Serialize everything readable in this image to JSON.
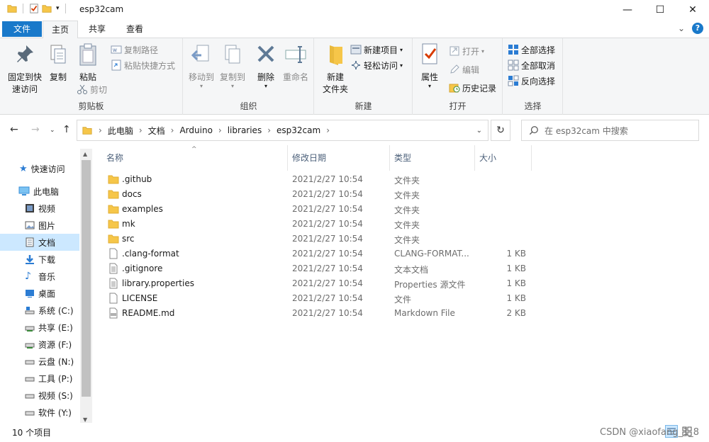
{
  "window": {
    "title": "esp32cam",
    "minimize": "—",
    "maximize": "☐",
    "close": "✕"
  },
  "tabs": {
    "file": "文件",
    "home": "主页",
    "share": "共享",
    "view": "查看",
    "expand": "⌄",
    "help": "?"
  },
  "ribbon": {
    "clipboard": {
      "label": "剪贴板",
      "pin": "固定到快\n速访问",
      "copy": "复制",
      "paste": "粘贴",
      "copy_path": "复制路径",
      "paste_shortcut": "粘贴快捷方式",
      "cut": "剪切"
    },
    "organize": {
      "label": "组织",
      "move_to": "移动到",
      "copy_to": "复制到",
      "delete": "删除",
      "rename": "重命名"
    },
    "new": {
      "label": "新建",
      "new_folder": "新建\n文件夹",
      "new_item": "新建项目",
      "easy_access": "轻松访问"
    },
    "open": {
      "label": "打开",
      "properties": "属性",
      "open": "打开",
      "edit": "编辑",
      "history": "历史记录"
    },
    "select": {
      "label": "选择",
      "select_all": "全部选择",
      "select_none": "全部取消",
      "invert": "反向选择"
    }
  },
  "address": {
    "crumbs": [
      "此电脑",
      "文档",
      "Arduino",
      "libraries",
      "esp32cam"
    ],
    "search_placeholder": "在 esp32cam 中搜索"
  },
  "sidebar": {
    "items": [
      {
        "label": "快速访问",
        "icon": "star-icon",
        "color": "#2b7cd3"
      },
      {
        "label": "此电脑",
        "icon": "computer-icon",
        "color": "#3a8fd8"
      },
      {
        "label": "视频",
        "icon": "video-icon",
        "color": "#5a5a5a"
      },
      {
        "label": "图片",
        "icon": "picture-icon",
        "color": "#5a5a5a"
      },
      {
        "label": "文档",
        "icon": "document-icon",
        "color": "#5a5a5a"
      },
      {
        "label": "下载",
        "icon": "download-icon",
        "color": "#2b7cd3"
      },
      {
        "label": "音乐",
        "icon": "music-icon",
        "color": "#2b7cd3"
      },
      {
        "label": "桌面",
        "icon": "desktop-icon",
        "color": "#2b7cd3"
      },
      {
        "label": "系统 (C:)",
        "icon": "drive-icon",
        "color": "#5a5a5a"
      },
      {
        "label": "共享 (E:)",
        "icon": "drive-icon",
        "color": "#5a5a5a"
      },
      {
        "label": "资源 (F:)",
        "icon": "drive-icon",
        "color": "#5a5a5a"
      },
      {
        "label": "云盘 (N:)",
        "icon": "drive-icon",
        "color": "#5a5a5a"
      },
      {
        "label": "工具 (P:)",
        "icon": "drive-icon",
        "color": "#5a5a5a"
      },
      {
        "label": "视频 (S:)",
        "icon": "drive-icon",
        "color": "#5a5a5a"
      },
      {
        "label": "软件 (Y:)",
        "icon": "drive-icon",
        "color": "#5a5a5a"
      }
    ]
  },
  "list": {
    "columns": {
      "name": "名称",
      "date": "修改日期",
      "type": "类型",
      "size": "大小"
    },
    "rows": [
      {
        "name": ".github",
        "date": "2021/2/27 10:54",
        "type": "文件夹",
        "size": "",
        "icon": "folder-icon"
      },
      {
        "name": "docs",
        "date": "2021/2/27 10:54",
        "type": "文件夹",
        "size": "",
        "icon": "folder-icon"
      },
      {
        "name": "examples",
        "date": "2021/2/27 10:54",
        "type": "文件夹",
        "size": "",
        "icon": "folder-icon"
      },
      {
        "name": "mk",
        "date": "2021/2/27 10:54",
        "type": "文件夹",
        "size": "",
        "icon": "folder-icon"
      },
      {
        "name": "src",
        "date": "2021/2/27 10:54",
        "type": "文件夹",
        "size": "",
        "icon": "folder-icon"
      },
      {
        "name": ".clang-format",
        "date": "2021/2/27 10:54",
        "type": "CLANG-FORMAT...",
        "size": "1 KB",
        "icon": "file-icon"
      },
      {
        "name": ".gitignore",
        "date": "2021/2/27 10:54",
        "type": "文本文档",
        "size": "1 KB",
        "icon": "text-file-icon"
      },
      {
        "name": "library.properties",
        "date": "2021/2/27 10:54",
        "type": "Properties 源文件",
        "size": "1 KB",
        "icon": "text-file-icon"
      },
      {
        "name": "LICENSE",
        "date": "2021/2/27 10:54",
        "type": "文件",
        "size": "1 KB",
        "icon": "file-icon"
      },
      {
        "name": "README.md",
        "date": "2021/2/27 10:54",
        "type": "Markdown File",
        "size": "2 KB",
        "icon": "md-file-icon"
      }
    ]
  },
  "status": {
    "count": "10 个项目",
    "watermark": "CSDN @xiaofang_1_8"
  },
  "colors": {
    "accent": "#1979ca",
    "selected": "#cce8ff",
    "folder": "#f6c649"
  }
}
